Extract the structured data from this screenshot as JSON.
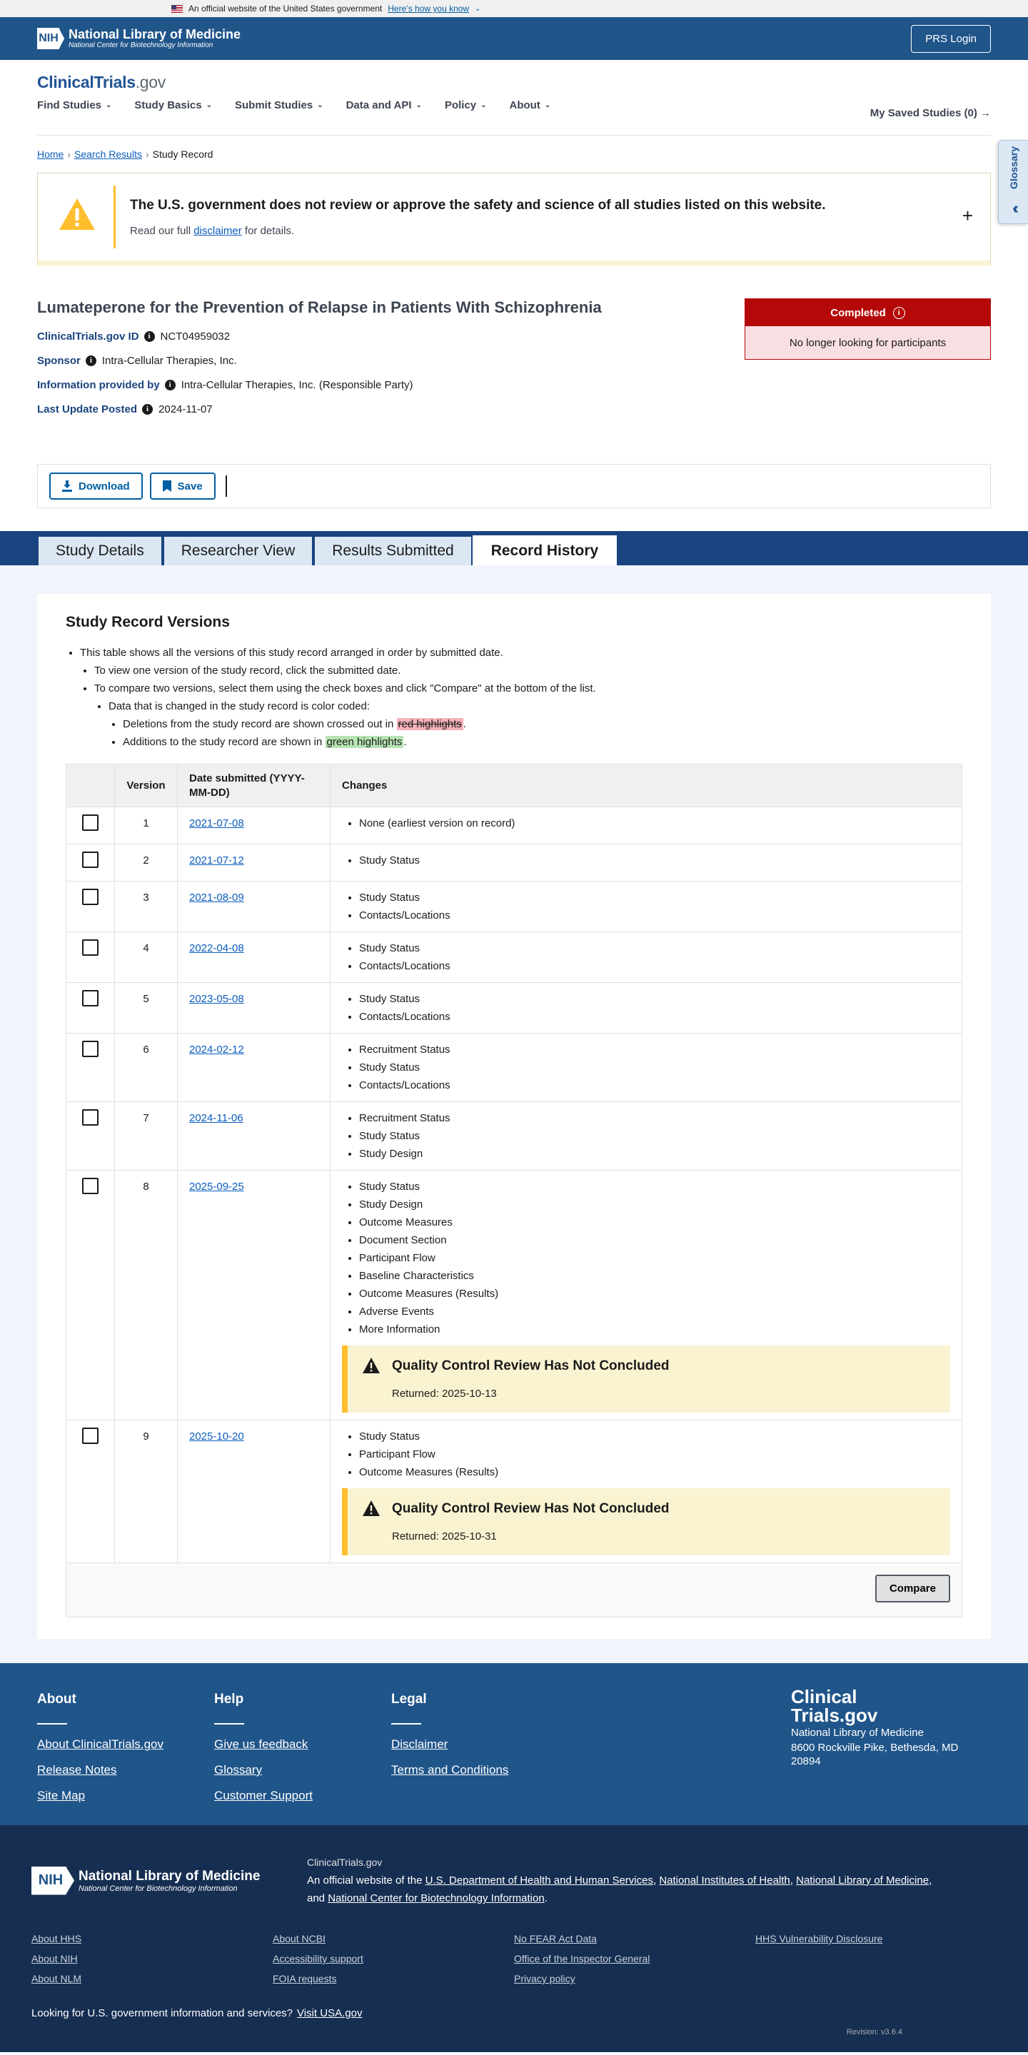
{
  "gov_banner": {
    "text": "An official website of the United States government",
    "link": "Here’s how you know"
  },
  "nih": {
    "mark": "NIH",
    "title": "National Library of Medicine",
    "subtitle": "National Center for Biotechnology Information",
    "prs_login": "PRS Login"
  },
  "header": {
    "logo_main": "ClinicalTrials",
    "logo_suffix": ".gov",
    "nav": [
      "Find Studies",
      "Study Basics",
      "Submit Studies",
      "Data and API",
      "Policy",
      "About"
    ],
    "saved": "My Saved Studies (0) →"
  },
  "glossary": {
    "label": "Glossary"
  },
  "breadcrumb": {
    "home": "Home",
    "search": "Search Results",
    "current": "Study Record"
  },
  "alert": {
    "heading": "The U.S. government does not review or approve the safety and science of all studies listed on this website.",
    "text_before": "Read our full ",
    "link": "disclaimer",
    "text_after": " for details."
  },
  "study": {
    "title": "Lumateperone for the Prevention of Relapse in Patients With Schizophrenia",
    "id_label": "ClinicalTrials.gov ID",
    "id": "NCT04959032",
    "sponsor_label": "Sponsor",
    "sponsor": "Intra-Cellular Therapies, Inc.",
    "info_label": "Information provided by",
    "info": "Intra-Cellular Therapies, Inc. (Responsible Party)",
    "update_label": "Last Update Posted",
    "update": "2024-11-07",
    "status": "Completed",
    "status_detail": "No longer looking for participants"
  },
  "toolbar": {
    "download": "Download",
    "save": "Save"
  },
  "tabs": [
    "Study Details",
    "Researcher View",
    "Results Submitted",
    "Record History"
  ],
  "versions_section": {
    "title": "Study Record Versions",
    "b1": "This table shows all the versions of this study record arranged in order by submitted date.",
    "b2": "To view one version of the study record, click the submitted date.",
    "b3": "To compare two versions, select them using the check boxes and click \"Compare\" at the bottom of the list.",
    "b4": "Data that is changed in the study record is color coded:",
    "b5_before": "Deletions from the study record are shown crossed out in ",
    "b5_hl": "red highlights",
    "b5_after": ".",
    "b6_before": "Additions to the study record are shown in ",
    "b6_hl": "green highlights",
    "b6_after": "."
  },
  "table": {
    "headers": {
      "version": "Version",
      "date": "Date submitted (YYYY-MM-DD)",
      "changes": "Changes"
    },
    "rows": [
      {
        "version": "1",
        "date": "2021-07-08",
        "changes": [
          "None (earliest version on record)"
        ]
      },
      {
        "version": "2",
        "date": "2021-07-12",
        "changes": [
          "Study Status"
        ]
      },
      {
        "version": "3",
        "date": "2021-08-09",
        "changes": [
          "Study Status",
          "Contacts/Locations"
        ]
      },
      {
        "version": "4",
        "date": "2022-04-08",
        "changes": [
          "Study Status",
          "Contacts/Locations"
        ]
      },
      {
        "version": "5",
        "date": "2023-05-08",
        "changes": [
          "Study Status",
          "Contacts/Locations"
        ]
      },
      {
        "version": "6",
        "date": "2024-02-12",
        "changes": [
          "Recruitment Status",
          "Study Status",
          "Contacts/Locations"
        ]
      },
      {
        "version": "7",
        "date": "2024-11-06",
        "changes": [
          "Recruitment Status",
          "Study Status",
          "Study Design"
        ]
      },
      {
        "version": "8",
        "date": "2025-09-25",
        "changes": [
          "Study Status",
          "Study Design",
          "Outcome Measures",
          "Document Section",
          "Participant Flow",
          "Baseline Characteristics",
          "Outcome Measures (Results)",
          "Adverse Events",
          "More Information"
        ],
        "qc": {
          "title": "Quality Control Review Has Not Concluded",
          "returned": "Returned: 2025-10-13"
        }
      },
      {
        "version": "9",
        "date": "2025-10-20",
        "changes": [
          "Study Status",
          "Participant Flow",
          "Outcome Measures (Results)"
        ],
        "qc": {
          "title": "Quality Control Review Has Not Concluded",
          "returned": "Returned: 2025-10-31"
        }
      }
    ],
    "compare": "Compare"
  },
  "footer": {
    "about": {
      "title": "About",
      "links": [
        "About ClinicalTrials.gov",
        "Release Notes",
        "Site Map"
      ]
    },
    "help": {
      "title": "Help",
      "links": [
        "Give us feedback",
        "Glossary",
        "Customer Support"
      ]
    },
    "legal": {
      "title": "Legal",
      "links": [
        "Disclaimer",
        "Terms and Conditions"
      ]
    },
    "brand_line1": "Clinical",
    "brand_line2": "Trials.gov",
    "org": "National Library of Medicine",
    "address": "8600 Rockville Pike, Bethesda, MD 20894"
  },
  "footer2": {
    "site": "ClinicalTrials.gov",
    "gov_text_1": "An official website of the ",
    "hhs": "U.S. Department of Health and Human Services",
    "nih_link": "National Institutes of Health",
    "nlm": "National Library of Medicine",
    "and": "and ",
    "ncbi": "National Center for Biotechnology Information",
    "links": [
      [
        "About HHS",
        "About NIH",
        "About NLM"
      ],
      [
        "About NCBI",
        "Accessibility support",
        "FOIA requests"
      ],
      [
        "No FEAR Act Data",
        "Office of the Inspector General",
        "Privacy policy"
      ],
      [
        "HHS Vulnerability Disclosure"
      ]
    ],
    "usa_text": "Looking for U.S. government information and services?",
    "usa_link": "Visit USA.gov",
    "revision": "Revision: v3.6.4"
  },
  "colors": {
    "nih_blue": "#20558a",
    "tab_blue": "#1a4480",
    "status_red": "#b50909",
    "warning": "#ffbe2e"
  }
}
